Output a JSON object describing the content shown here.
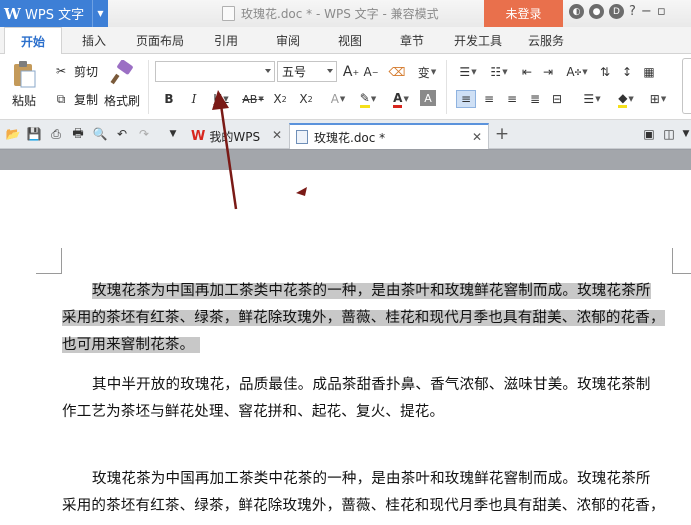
{
  "app": {
    "name": "WPS 文字",
    "doc_title": "玫瑰花.doc * - WPS 文字 - 兼容模式",
    "login_label": "未登录"
  },
  "menu": {
    "tabs": [
      "开始",
      "插入",
      "页面布局",
      "引用",
      "审阅",
      "视图",
      "章节",
      "开发工具",
      "云服务"
    ]
  },
  "ribbon": {
    "paste_label": "粘贴",
    "cut_label": "剪切",
    "copy_label": "复制",
    "format_painter_label": "格式刷",
    "font_name": "",
    "font_size": "五号"
  },
  "doc_tabs": {
    "tab1": "我的WPS",
    "tab2": "玫瑰花.doc *"
  },
  "document": {
    "p1_line1": "玫瑰花茶为中国再加工茶类中花茶的一种，是由茶叶和玫瑰鲜花窨制而成。玫瑰花茶所",
    "p1_line2": "采用的茶坯有红茶、绿茶，鲜花除玫瑰外，蔷薇、桂花和现代月季也具有甜美、浓郁的花香，",
    "p1_line3": "也可用来窨制花茶。",
    "p2_line1": "其中半开放的玫瑰花，品质最佳。成品茶甜香扑鼻、香气浓郁、滋味甘美。玫瑰花茶制",
    "p2_line2": "作工艺为茶坯与鲜花处理、窨花拼和、起花、复火、提花。",
    "p3_line1": "玫瑰花茶为中国再加工茶类中花茶的一种，是由茶叶和玫瑰鲜花窨制而成。玫瑰花茶所",
    "p3_line2": "采用的茶坯有红茶、绿茶，鲜花除玫瑰外，蔷薇、桂花和现代月季也具有甜美、浓郁的花香，"
  },
  "colors": {
    "accent": "#3d7fd6",
    "login": "#e9704c",
    "selection": "#c8c8c8",
    "annotation": "#7a1a16"
  }
}
